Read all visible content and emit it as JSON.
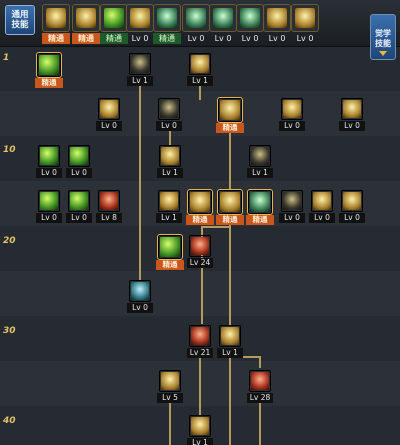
{
  "top_tabs": {
    "common_label": "通用\n技能",
    "items": [
      {
        "icon": "martial-figure-icon",
        "level": "精通",
        "style": "orange"
      },
      {
        "icon": "flame-swirl-icon",
        "level": "精通",
        "style": "orange"
      },
      {
        "icon": "burst-fist-icon",
        "level": "精通",
        "style": "green"
      },
      {
        "icon": "leaf-wing-icon",
        "level": "Lv 0",
        "style": "plain"
      },
      {
        "icon": "green-orb-icon",
        "level": "精通",
        "style": "green"
      },
      {
        "icon": "kick-icon",
        "level": "Lv 0",
        "style": "plain"
      },
      {
        "icon": "dash-icon",
        "level": "Lv 0",
        "style": "plain"
      },
      {
        "icon": "vortex-icon",
        "level": "Lv 0",
        "style": "plain"
      },
      {
        "icon": "golden-warrior-icon",
        "level": "Lv 0",
        "style": "plain"
      },
      {
        "icon": "spark-icon",
        "level": "Lv 0",
        "style": "plain"
      }
    ],
    "usage_button": "觉学\n技能"
  },
  "level_markers": [
    "1",
    "10",
    "20",
    "30",
    "40"
  ],
  "skills": [
    {
      "name": "skill-r1-green-orb",
      "level": "精通",
      "style": "orange",
      "color": "g-green"
    },
    {
      "name": "skill-r1-claw",
      "level": "Lv 1",
      "style": "plain",
      "color": "g-dark"
    },
    {
      "name": "skill-r1-sweep",
      "level": "Lv 1",
      "style": "plain",
      "color": "g-gold"
    },
    {
      "name": "skill-r2-wings",
      "level": "Lv 0",
      "style": "plain",
      "color": "g-gold"
    },
    {
      "name": "skill-r2-arrow",
      "level": "Lv 0",
      "style": "plain",
      "color": "g-dark"
    },
    {
      "name": "skill-r2-tornado",
      "level": "精通",
      "style": "orange",
      "color": "g-gold"
    },
    {
      "name": "skill-r2-shield",
      "level": "Lv 0",
      "style": "plain",
      "color": "g-gold"
    },
    {
      "name": "skill-r2-trident",
      "level": "Lv 0",
      "style": "plain",
      "color": "g-gold"
    },
    {
      "name": "skill-r3-green-sword",
      "level": "Lv 0",
      "style": "plain",
      "color": "g-green"
    },
    {
      "name": "skill-r3-green-blade",
      "level": "Lv 0",
      "style": "plain",
      "color": "g-green"
    },
    {
      "name": "skill-r3-crown",
      "level": "Lv 1",
      "style": "plain",
      "color": "g-gold"
    },
    {
      "name": "skill-r3-spiral",
      "level": "Lv 1",
      "style": "plain",
      "color": "g-dark"
    },
    {
      "name": "skill-r4-green-dagger",
      "level": "Lv 0",
      "style": "plain",
      "color": "g-green"
    },
    {
      "name": "skill-r4-green-star",
      "level": "Lv 0",
      "style": "plain",
      "color": "g-green"
    },
    {
      "name": "skill-r4-red-bolt",
      "level": "Lv 8",
      "style": "plain",
      "color": "g-red"
    },
    {
      "name": "skill-r4-crescent",
      "level": "Lv 1",
      "style": "plain",
      "color": "g-gold"
    },
    {
      "name": "skill-r4-shield-claw",
      "level": "精通",
      "style": "orange",
      "color": "g-gold"
    },
    {
      "name": "skill-r4-lion",
      "level": "精通",
      "style": "orange",
      "color": "g-gold"
    },
    {
      "name": "skill-r4-moon",
      "level": "精通",
      "style": "orange",
      "color": "g-teal"
    },
    {
      "name": "skill-r4-wind",
      "level": "Lv 0",
      "style": "plain",
      "color": "g-dark"
    },
    {
      "name": "skill-r4-cross",
      "level": "Lv 0",
      "style": "plain",
      "color": "g-gold"
    },
    {
      "name": "skill-r4-fire",
      "level": "Lv 0",
      "style": "plain",
      "color": "g-gold"
    },
    {
      "name": "skill-r5-green-fist",
      "level": "精通",
      "style": "orange",
      "color": "g-green"
    },
    {
      "name": "skill-r5-red-stack",
      "level": "Lv 24",
      "style": "plain",
      "color": "g-red"
    },
    {
      "name": "skill-r6-wave",
      "level": "Lv 0",
      "style": "plain",
      "color": "g-blue"
    },
    {
      "name": "skill-r7-red-dash",
      "level": "Lv 21",
      "style": "plain",
      "color": "g-red"
    },
    {
      "name": "skill-r7-gold-fist",
      "level": "Lv 1",
      "style": "plain",
      "color": "g-gold"
    },
    {
      "name": "skill-r8-gold-pillar",
      "level": "Lv 5",
      "style": "plain",
      "color": "g-gold"
    },
    {
      "name": "skill-r8-red-flame",
      "level": "Lv 28",
      "style": "plain",
      "color": "g-red"
    },
    {
      "name": "skill-r9-gold-strike",
      "level": "Lv 1",
      "style": "plain",
      "color": "g-gold"
    }
  ]
}
